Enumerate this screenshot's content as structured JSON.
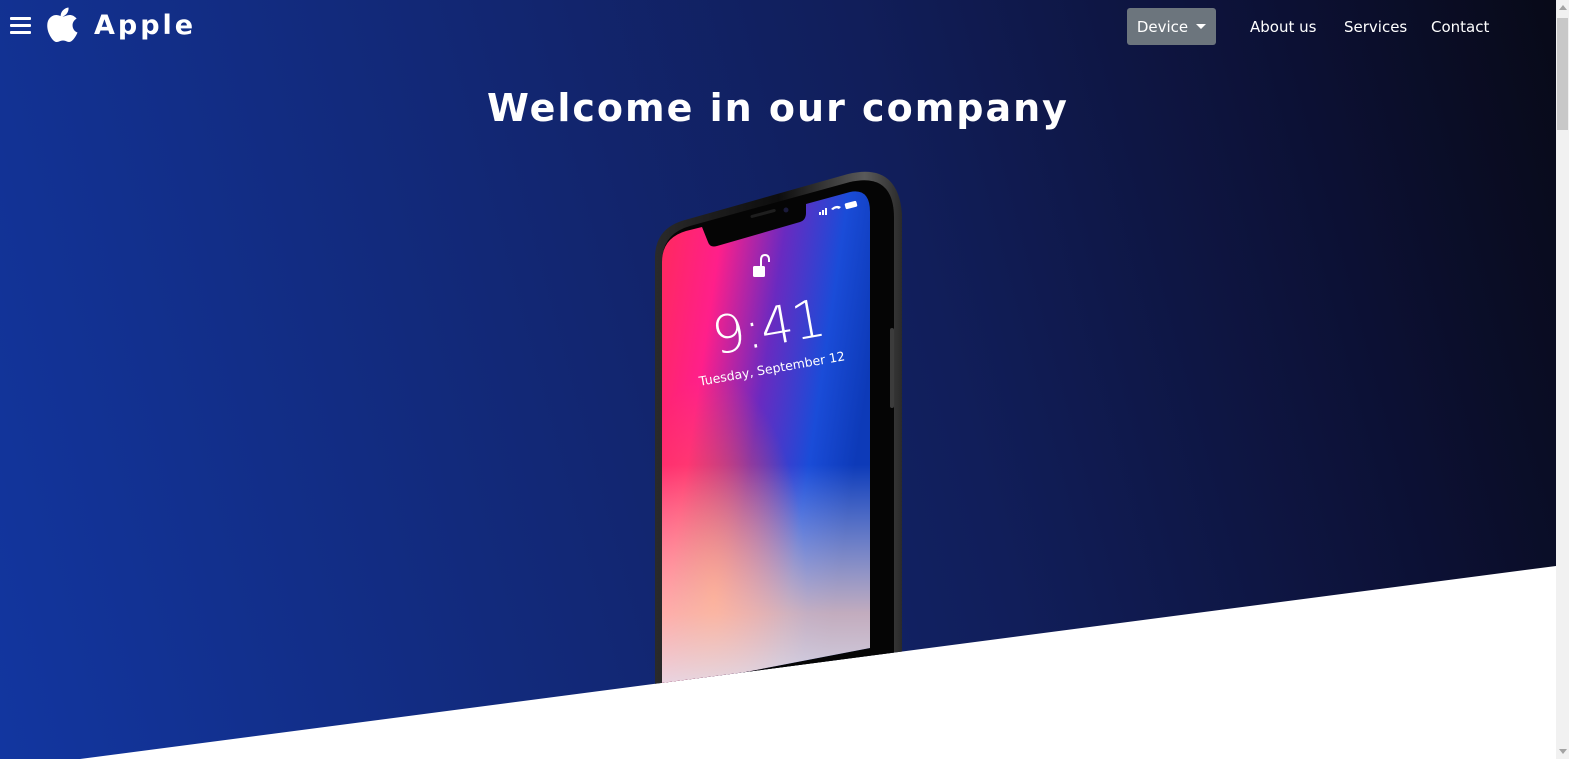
{
  "navbar": {
    "brand": "Apple",
    "links": [
      {
        "label": "Device"
      },
      {
        "label": "About us"
      },
      {
        "label": "Services"
      },
      {
        "label": "Contact"
      }
    ]
  },
  "hero": {
    "title": "Welcome in our company",
    "phone_screen": {
      "time": "9:41",
      "date": "Tuesday, September 12"
    }
  },
  "colors": {
    "hero_gradient_start": "#1236a0",
    "hero_gradient_end": "#080a18",
    "device_button": "#6c757d",
    "text": "#ffffff"
  },
  "icons": [
    "hamburger-menu-icon",
    "apple-logo-icon",
    "lock-icon",
    "signal-icon",
    "wifi-icon",
    "battery-icon"
  ]
}
